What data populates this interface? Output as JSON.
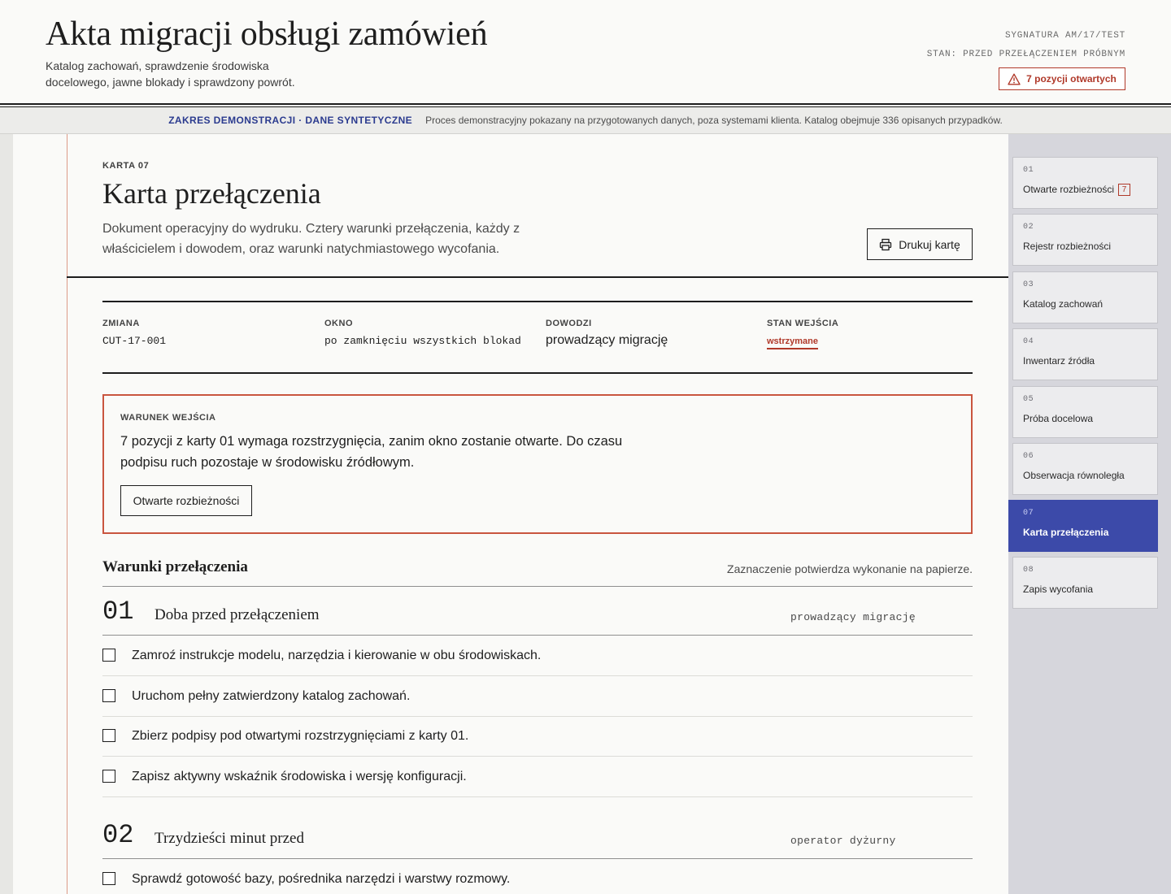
{
  "header": {
    "title": "Akta migracji obsługi zamówień",
    "subtitle": "Katalog zachowań, sprawdzenie środowiska docelowego, jawne blokady i sprawdzony powrót.",
    "signature": "SYGNATURA AM/17/TEST",
    "state": "STAN: PRZED PRZEŁĄCZENIEM PRÓBNYM",
    "open_items_label": "7 pozycji otwartych",
    "open_items_icon": "warning-triangle-icon"
  },
  "banner": {
    "label": "ZAKRES DEMONSTRACJI · DANE SYNTETYCZNE",
    "text": "Proces demonstracyjny pokazany na przygotowanych danych, poza systemami klienta. Katalog obejmuje 336 opisanych przypadków."
  },
  "card": {
    "kicker": "KARTA 07",
    "title": "Karta przełączenia",
    "description": "Dokument operacyjny do wydruku. Cztery warunki przełączenia, każdy z właścicielem i dowodem, oraz warunki natychmiastowego wycofania.",
    "print_label": "Drukuj kartę",
    "print_icon": "printer-icon"
  },
  "status": {
    "change_label": "ZMIANA",
    "change_value": "CUT-17-001",
    "window_label": "OKNO",
    "window_value": "po zamknięciu wszystkich blokad",
    "lead_label": "DOWODZI",
    "lead_value": "prowadzący migrację",
    "entry_label": "STAN WEJŚCIA",
    "entry_value": "wstrzymane"
  },
  "entry_condition": {
    "label": "WARUNEK WEJŚCIA",
    "text": "7 pozycji z karty 01 wymaga rozstrzygnięcia, zanim okno zostanie otwarte. Do czasu podpisu ruch pozostaje w środowisku źródłowym.",
    "button_label": "Otwarte rozbieżności"
  },
  "conditions": {
    "title": "Warunki przełączenia",
    "note": "Zaznaczenie potwierdza wykonanie na papierze.",
    "steps": [
      {
        "num": "01",
        "title": "Doba przed przełączeniem",
        "owner": "prowadzący migrację",
        "items": [
          "Zamroź instrukcje modelu, narzędzia i kierowanie w obu środowiskach.",
          "Uruchom pełny zatwierdzony katalog zachowań.",
          "Zbierz podpisy pod otwartymi rozstrzygnięciami z karty 01.",
          "Zapisz aktywny wskaźnik środowiska i wersję konfiguracji."
        ]
      },
      {
        "num": "02",
        "title": "Trzydzieści minut przed",
        "owner": "operator dyżurny",
        "items": [
          "Sprawdź gotowość bazy, pośrednika narzędzi i warstwy rozmowy."
        ]
      }
    ]
  },
  "sidebar": {
    "items": [
      {
        "num": "01",
        "label": "Otwarte rozbieżności",
        "badge": "7"
      },
      {
        "num": "02",
        "label": "Rejestr rozbieżności"
      },
      {
        "num": "03",
        "label": "Katalog zachowań"
      },
      {
        "num": "04",
        "label": "Inwentarz źródła"
      },
      {
        "num": "05",
        "label": "Próba docelowa"
      },
      {
        "num": "06",
        "label": "Obserwacja równoległa"
      },
      {
        "num": "07",
        "label": "Karta przełączenia",
        "active": true
      },
      {
        "num": "08",
        "label": "Zapis wycofania"
      }
    ]
  },
  "colors": {
    "accent": "#3c4aa9",
    "alert": "#b0392a",
    "banner_label": "#2b3b8f"
  }
}
